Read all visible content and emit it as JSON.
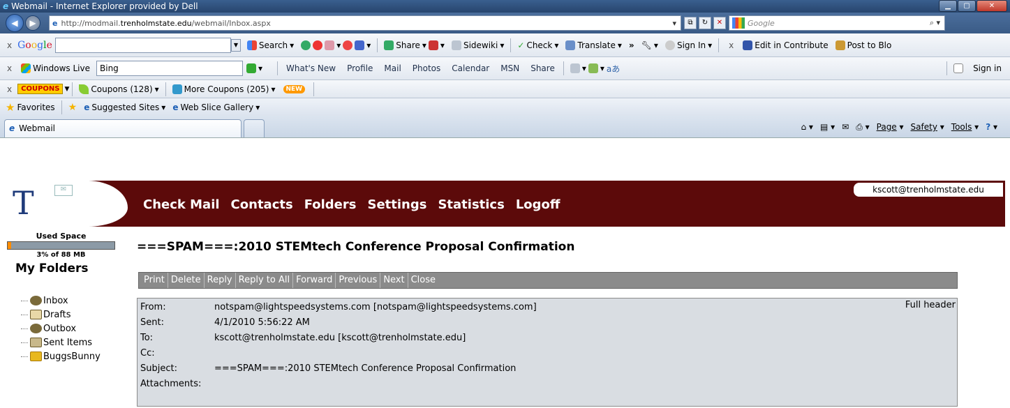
{
  "window": {
    "title": "Webmail - Internet Explorer provided by Dell"
  },
  "address": {
    "url_prefix": "http://modmail.",
    "url_domain": "trenholmstate.edu",
    "url_path": "/webmail/Inbox.aspx"
  },
  "search": {
    "placeholder": "Google"
  },
  "google_toolbar": {
    "logo": [
      "G",
      "o",
      "o",
      "g",
      "l",
      "e"
    ],
    "search_label": "Search",
    "share_label": "Share",
    "sidewiki_label": "Sidewiki",
    "check_label": "Check",
    "translate_label": "Translate",
    "more_label": "»",
    "signin_label": "Sign In",
    "contribute_label": "Edit in Contribute",
    "post_label": "Post to Blo"
  },
  "live_toolbar": {
    "brand": "Windows Live",
    "search_value": "Bing",
    "links": [
      "What's New",
      "Profile",
      "Mail",
      "Photos",
      "Calendar",
      "MSN",
      "Share"
    ],
    "signin_label": "Sign in"
  },
  "coupon_toolbar": {
    "logo": "COUPONS",
    "coupons_label": "Coupons (128)",
    "more_label": "More Coupons (205)",
    "new_badge": "NEW"
  },
  "favorites_bar": {
    "favorites_label": "Favorites",
    "suggested_label": "Suggested Sites",
    "slice_label": "Web Slice Gallery"
  },
  "tabs": {
    "active": "Webmail"
  },
  "command_bar": {
    "page": "Page",
    "safety": "Safety",
    "tools": "Tools"
  },
  "user": {
    "email": "kscott@trenholmstate.edu"
  },
  "nav": {
    "items": [
      "Check Mail",
      "Contacts",
      "Folders",
      "Settings",
      "Statistics",
      "Logoff"
    ]
  },
  "storage": {
    "label": "Used Space",
    "value": "3% of 88 MB",
    "fraction": 0.03
  },
  "folders": {
    "title": "My Folders",
    "items": [
      {
        "label": "Inbox",
        "icon": "inbox-icon",
        "color": "#7a6a3a"
      },
      {
        "label": "Drafts",
        "icon": "drafts-icon",
        "color": "#6b5a2a"
      },
      {
        "label": "Outbox",
        "icon": "outbox-icon",
        "color": "#7a6a3a"
      },
      {
        "label": "Sent Items",
        "icon": "sent-icon",
        "color": "#8a7a4a"
      },
      {
        "label": "BuggsBunny",
        "icon": "folder-icon",
        "color": "#e8b81e"
      }
    ]
  },
  "message": {
    "subject_title": "===SPAM===:2010 STEMtech Conference Proposal Confirmation",
    "actions": [
      "Print",
      "Delete",
      "Reply",
      "Reply to All",
      "Forward",
      "Previous",
      "Next",
      "Close"
    ],
    "full_header": "Full header",
    "headers": [
      {
        "key": "From:",
        "value": "notspam@lightspeedsystems.com [notspam@lightspeedsystems.com]"
      },
      {
        "key": "Sent:",
        "value": "4/1/2010 5:56:22 AM"
      },
      {
        "key": "To:",
        "value": "kscott@trenholmstate.edu [kscott@trenholmstate.edu]"
      },
      {
        "key": "Cc:",
        "value": ""
      },
      {
        "key": "Subject:",
        "value": "===SPAM===:2010 STEMtech Conference Proposal Confirmation"
      },
      {
        "key": "Attachments:",
        "value": ""
      }
    ]
  },
  "colors": {
    "header_bg": "#5c0a0a",
    "used_fill": "#ff8c00"
  }
}
